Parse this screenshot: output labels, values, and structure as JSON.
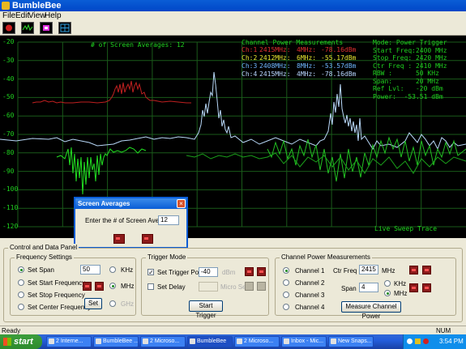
{
  "window": {
    "title": "BumbleBee"
  },
  "menu": [
    "File",
    "Edit",
    "View",
    "Help"
  ],
  "toolbar": {
    "icons": [
      "red-record-icon",
      "waveform-icon",
      "pink-icon",
      "grid-icon"
    ]
  },
  "display": {
    "y_ticks": [
      "-20",
      "-30",
      "-40",
      "-50",
      "-60",
      "-70",
      "-80",
      "-90",
      "-100",
      "-110",
      "-120"
    ],
    "averages_label": "# of Screen Averages: 12",
    "channel_power": {
      "title": "Channel Power Measurements",
      "rows": [
        {
          "ch": "Ch:1",
          "freq": "2415MHz:",
          "bw": "4MHz:",
          "power": "-78.16dBm",
          "color": "#E03030"
        },
        {
          "ch": "Ch:2",
          "freq": "2412MHz:",
          "bw": "6MHz:",
          "power": "-55.17dBm",
          "color": "#E6E630"
        },
        {
          "ch": "Ch:3",
          "freq": "2408MHz:",
          "bw": "8MHz:",
          "power": "-53.57dBm",
          "color": "#6FB6FF"
        },
        {
          "ch": "Ch:4",
          "freq": "2415MHz:",
          "bw": "4MHz:",
          "power": "-78.16dBm",
          "color": "#B8D6FF"
        }
      ]
    },
    "mode_info": [
      "Mode: Power Trigger",
      "Start Freq:2400 MHz",
      "Stop Freq: 2420 MHz",
      "Ctr Freq : 2410 MHz",
      "RBW :      50 KHz",
      "Span:      20 MHz",
      "Ref Lvl:   -20 dBm",
      "Power:  -53.51 dBm"
    ],
    "live_label": "Live Sweep Trace"
  },
  "dialog": {
    "title": "Screen Averages",
    "prompt": "Enter the # of Screen Averages:",
    "value": "12"
  },
  "panel": {
    "title": "Control and Data Panel",
    "freq_settings": {
      "title": "Frequency Settings",
      "set_span": "Set Span",
      "set_start": "Set Start Frequency",
      "set_stop": "Set Stop Frequency",
      "set_center": "Set Center Frequency",
      "value": "50",
      "unit_khz": "KHz",
      "unit_mhz": "MHz",
      "unit_ghz": "GHz",
      "set_button": "Set"
    },
    "trigger": {
      "title": "Trigger Mode",
      "set_trigger_power": "Set Trigger Power",
      "trigger_value": "-40",
      "dbm_unit": "dBm",
      "set_delay": "Set Delay",
      "micro_sec": "Micro Sec",
      "start_button": "Start Trigger"
    },
    "channel_power": {
      "title": "Channel Power Measurements",
      "channels": [
        "Channel 1",
        "Channel 2",
        "Channel 3",
        "Channel 4"
      ],
      "ctr_freq_label": "Ctr Freq",
      "ctr_freq_value": "2415",
      "ctr_unit": "MHz",
      "span_label": "Span",
      "span_value": "4",
      "span_khz": "KHz",
      "span_mhz": "MHz",
      "measure_button": "Measure Channel Power"
    }
  },
  "statusbar": {
    "left": "Ready",
    "right": "NUM"
  },
  "taskbar": {
    "start": "start",
    "items": [
      "2 Interne...",
      "BumbleBee ...",
      "2 Microso...",
      "BumbleBee",
      "2 Microso...",
      "Inbox - Mic...",
      "New Snaps..."
    ],
    "clock": "3:54 PM"
  }
}
